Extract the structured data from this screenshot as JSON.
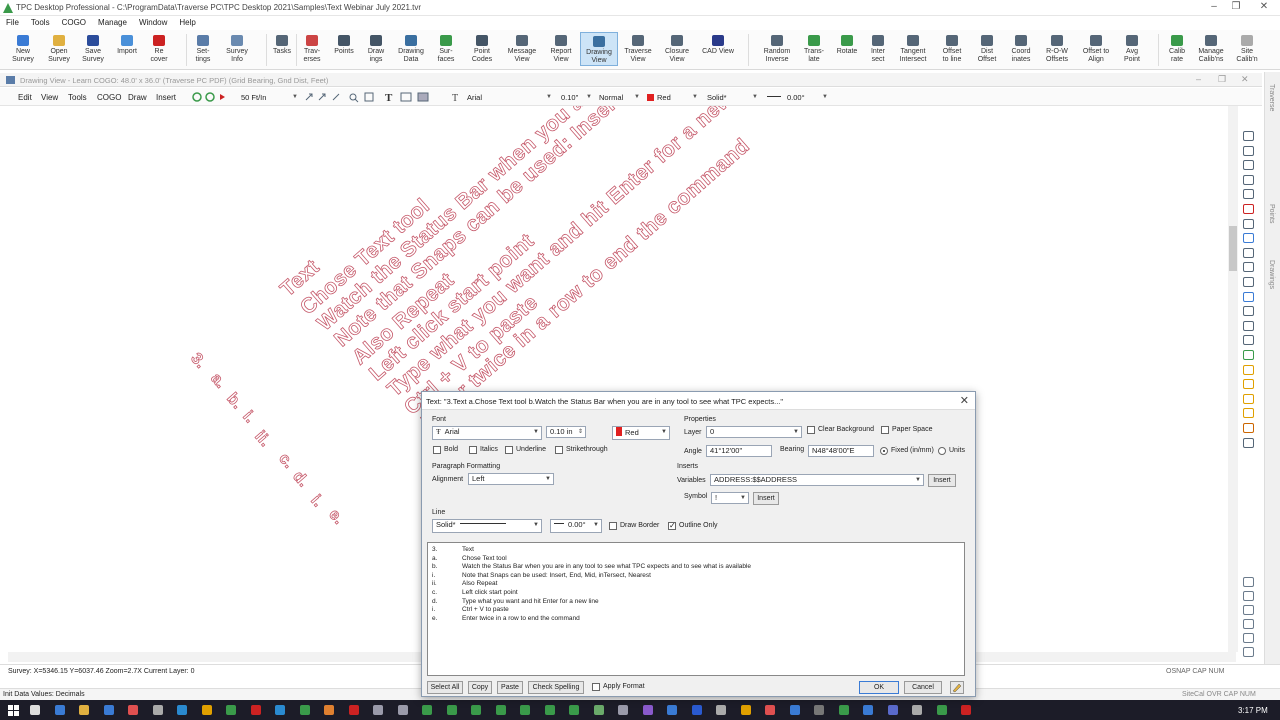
{
  "app": {
    "title": "TPC Desktop Professional - C:\\ProgramData\\Traverse PC\\TPC Desktop 2021\\Samples\\Text Webinar July 2021.tvr",
    "menu": [
      "File",
      "Tools",
      "COGO",
      "Manage",
      "Window",
      "Help"
    ]
  },
  "ribbon": [
    {
      "label": "New\nSurvey",
      "icon": "new-survey-icon",
      "color": "#3a7bd5"
    },
    {
      "label": "Open\nSurvey",
      "icon": "open-folder-icon",
      "color": "#e0b040"
    },
    {
      "label": "Save\nSurvey",
      "icon": "save-icon",
      "color": "#2b4c9b"
    },
    {
      "label": "Import",
      "icon": "import-icon",
      "color": "#4a90d9"
    },
    {
      "label": "Re\ncover",
      "icon": "recover-icon",
      "color": "#cc2222"
    },
    {
      "label": "Set-\ntings",
      "icon": "settings-icon",
      "color": "#5a7ca8"
    },
    {
      "label": "Survey\nInfo",
      "icon": "info-icon",
      "color": "#6a8ab0"
    },
    {
      "label": "Tasks",
      "icon": "tasks-icon",
      "color": "#556677"
    },
    {
      "label": "Trav-\nerses",
      "icon": "traverses-icon",
      "color": "#cc4444"
    },
    {
      "label": "Points",
      "icon": "points-icon",
      "color": "#445566"
    },
    {
      "label": "Draw\nings",
      "icon": "drawings-icon",
      "color": "#445566"
    },
    {
      "label": "Drawing\nData",
      "icon": "drawing-data-icon",
      "color": "#3a6fa0"
    },
    {
      "label": "Sur-\nfaces",
      "icon": "surfaces-icon",
      "color": "#3a9a4a"
    },
    {
      "label": "Point\nCodes",
      "icon": "point-codes-icon",
      "color": "#445566"
    },
    {
      "label": "Message\nView",
      "icon": "message-icon",
      "color": "#556677"
    },
    {
      "label": "Report\nView",
      "icon": "report-icon",
      "color": "#556677"
    },
    {
      "label": "Drawing\nView",
      "icon": "drawing-view-icon",
      "color": "#3a6fa0"
    },
    {
      "label": "Traverse\nView",
      "icon": "traverse-view-icon",
      "color": "#556677"
    },
    {
      "label": "Closure\nView",
      "icon": "closure-view-icon",
      "color": "#556677"
    },
    {
      "label": "CAD View",
      "icon": "cad-view-icon",
      "color": "#2a3a8a"
    },
    {
      "label": "Random\nInverse",
      "icon": "random-inverse-icon",
      "color": "#556677"
    },
    {
      "label": "Trans-\nlate",
      "icon": "translate-icon",
      "color": "#3a9a4a"
    },
    {
      "label": "Rotate",
      "icon": "rotate-icon",
      "color": "#3a9a4a"
    },
    {
      "label": "Inter\nsect",
      "icon": "intersect-icon",
      "color": "#556677"
    },
    {
      "label": "Tangent\nIntersect",
      "icon": "tangent-intersect-icon",
      "color": "#556677"
    },
    {
      "label": "Offset\nto line",
      "icon": "offset-line-icon",
      "color": "#556677"
    },
    {
      "label": "Dist\nOffset",
      "icon": "dist-offset-icon",
      "color": "#556677"
    },
    {
      "label": "Coord\ninates",
      "icon": "coordinates-icon",
      "color": "#556677"
    },
    {
      "label": "R-O-W\nOffsets",
      "icon": "row-offsets-icon",
      "color": "#556677"
    },
    {
      "label": "Offset to\nAlign",
      "icon": "offset-align-icon",
      "color": "#556677"
    },
    {
      "label": "Avg\nPoint",
      "icon": "avg-point-icon",
      "color": "#556677"
    },
    {
      "label": "Calib\nrate",
      "icon": "calibrate-icon",
      "color": "#3a9a4a"
    },
    {
      "label": "Manage\nCalib'ns",
      "icon": "manage-calib-icon",
      "color": "#556677"
    },
    {
      "label": "Site\nCalib'n",
      "icon": "site-calib-icon",
      "color": "#aaaaaa"
    }
  ],
  "drawing_view": {
    "title": "Drawing View - Learn COGO: 48.0' x 36.0' (Traverse PC PDF) (Grid Bearing, Gnd Dist, Feet)",
    "menu": [
      "Edit",
      "View",
      "Tools",
      "COGO",
      "Draw",
      "Insert"
    ],
    "scale": "50 Ft/In",
    "font": "Arial",
    "size": "0.10\"",
    "weight": "Normal",
    "color_name": "Red",
    "color_hex": "#e02020",
    "linetype": "Solid*",
    "angle": "0.00°"
  },
  "canvas_text": {
    "diagonal_lines": [
      "Text",
      "Chose Text tool",
      "Watch the Status Bar when you are in any tool",
      "Note that Snaps can be used: Insert,",
      "Also Repeat",
      "Left click start point",
      "Type what you want and hit Enter for a new line",
      "Ctrl + V to paste",
      "Enter twice in a row to end the command"
    ],
    "vertical_labels": [
      "3.",
      "a.",
      "b.",
      "i.",
      "ii.",
      "c.",
      "d.",
      "i.",
      "e."
    ]
  },
  "dialog": {
    "title": "Text: \"3.Text  a.Chose Text tool b.Watch the Status Bar when you are in any tool to see what TPC expects...\"",
    "font_section": "Font",
    "font": "Arial",
    "font_size": "0.10 in",
    "color": "Red",
    "color_hex": "#e02020",
    "bold": "Bold",
    "italics": "Italics",
    "underline": "Underline",
    "strikethrough": "Strikethrough",
    "paragraph_section": "Paragraph Formatting",
    "alignment_label": "Alignment",
    "alignment": "Left",
    "properties_section": "Properties",
    "layer_label": "Layer",
    "layer": "0",
    "clear_background": "Clear Background",
    "paper_space": "Paper Space",
    "angle_label": "Angle",
    "angle": "41°12'00\"",
    "bearing_label": "Bearing",
    "bearing": "N48°48'00\"E",
    "fixed_label": "Fixed (in/mm)",
    "units_label": "Units",
    "inserts_section": "Inserts",
    "variables_label": "Variables",
    "variables": "ADDRESS:$$ADDRESS",
    "insert_button": "Insert",
    "symbol_label": "Symbol",
    "symbol": "!",
    "insert_button2": "Insert",
    "line_section": "Line",
    "linetype": "Solid*",
    "line_angle": "0.00°",
    "draw_border": "Draw Border",
    "outline_only": "Outline Only",
    "text_lines": [
      {
        "n": "3.",
        "t": "Text"
      },
      {
        "n": "a.",
        "t": "Chose Text tool"
      },
      {
        "n": "b.",
        "t": "Watch the Status Bar when you are in any tool to see what TPC expects and to see what is available"
      },
      {
        "n": "i.",
        "t": "Note that Snaps can be used: Insert, End, Mid, inTersect, Nearest"
      },
      {
        "n": "ii.",
        "t": "Also Repeat"
      },
      {
        "n": "c.",
        "t": "Left click start point"
      },
      {
        "n": "d.",
        "t": "Type what you want and hit Enter for a new line"
      },
      {
        "n": "i.",
        "t": "Ctrl + V to paste"
      },
      {
        "n": "e.",
        "t": "Enter twice in a row to end the command"
      }
    ],
    "select_all": "Select All",
    "copy": "Copy",
    "paste": "Paste",
    "check_spelling": "Check Spelling",
    "apply_format": "Apply Format",
    "ok": "OK",
    "cancel": "Cancel"
  },
  "status": {
    "coords": "Survey: X=5346.15 Y=6037.46 Zoom=2.7X  Current Layer: 0",
    "snaps": "OSNAP  CAP  NUM",
    "init": "Init Data Values: Decimals",
    "right": "SiteCal  OVR  CAP  NUM"
  },
  "right_dock": [
    "Traverse",
    "Points",
    "Drawings"
  ],
  "taskbar": {
    "time": "3:17 PM"
  }
}
